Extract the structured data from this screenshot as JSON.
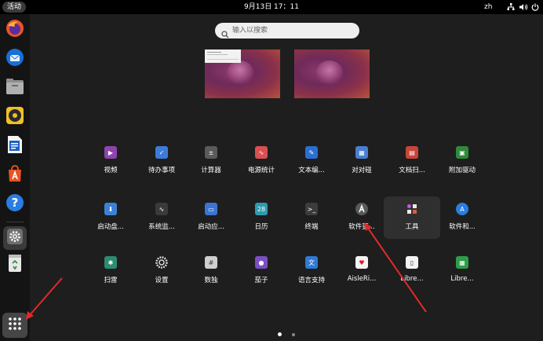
{
  "topbar": {
    "activities_label": "活动",
    "clock": "9月13日  17：11",
    "input_method": "zh",
    "tray_icons": [
      "network-icon",
      "volume-icon",
      "power-icon"
    ]
  },
  "search": {
    "placeholder": "输入以搜索"
  },
  "dock": {
    "items": [
      "firefox-icon",
      "thunderbird-icon",
      "files-icon",
      "rhythmbox-icon",
      "writer-icon",
      "software-store-icon",
      "help-icon",
      "settings-icon",
      "trash-icon",
      "show-apps-icon"
    ]
  },
  "app_grid": {
    "rows": [
      [
        {
          "label": "视频",
          "icon": "videos-icon",
          "color": "#8e44ad"
        },
        {
          "label": "待办事项",
          "icon": "todo-icon",
          "color": "#3d7bd9"
        },
        {
          "label": "计算器",
          "icon": "calculator-icon",
          "color": "#5a5a5a"
        },
        {
          "label": "电源统计",
          "icon": "power-statistics-icon",
          "color": "#d95050"
        },
        {
          "label": "文本编...",
          "icon": "text-editor-icon",
          "color": "#2c6fd1"
        },
        {
          "label": "对对碰",
          "icon": "tali-icon",
          "color": "#4a7fd0"
        },
        {
          "label": "文档扫...",
          "icon": "document-scanner-icon",
          "color": "#c8453a"
        },
        {
          "label": "附加驱动",
          "icon": "additional-drivers-icon",
          "color": "#2f8a3a"
        }
      ],
      [
        {
          "label": "启动盘...",
          "icon": "startup-disk-icon",
          "color": "#3b82d6"
        },
        {
          "label": "系统监...",
          "icon": "system-monitor-icon",
          "color": "#3a3a3a"
        },
        {
          "label": "启动应...",
          "icon": "startup-apps-icon",
          "color": "#3a75d4"
        },
        {
          "label": "日历",
          "icon": "calendar-icon",
          "color": "#2d9bb0"
        },
        {
          "label": "终端",
          "icon": "terminal-icon",
          "color": "#3c3c3c"
        },
        {
          "label": "软件更...",
          "icon": "software-updater-icon",
          "color": "#6b6b6b"
        },
        {
          "label": "工具",
          "icon": "utilities-folder-icon",
          "color": "#2f2f2f"
        },
        {
          "label": "软件和...",
          "icon": "software-and-updates-icon",
          "color": "#2b7de0"
        }
      ],
      [
        {
          "label": "扫雷",
          "icon": "mines-icon",
          "color": "#2e8b70"
        },
        {
          "label": "设置",
          "icon": "settings-icon",
          "color": "#5a5a5a"
        },
        {
          "label": "数独",
          "icon": "sudoku-icon",
          "color": "#cfcfcf"
        },
        {
          "label": "茄子",
          "icon": "cheese-icon",
          "color": "#7b4fc4"
        },
        {
          "label": "语言支持",
          "icon": "language-support-icon",
          "color": "#2f7ad6"
        },
        {
          "label": "AisleRi...",
          "icon": "aisleriot-icon",
          "color": "#f3f3f3"
        },
        {
          "label": "Libre...",
          "icon": "libreoffice-icon",
          "color": "#f3f3f3"
        },
        {
          "label": "Libre...",
          "icon": "libreoffice-calc-icon",
          "color": "#2e9c48"
        }
      ]
    ]
  },
  "annotation_color": "#e02a2a",
  "page_dots": {
    "count": 2,
    "active_index": 0
  }
}
